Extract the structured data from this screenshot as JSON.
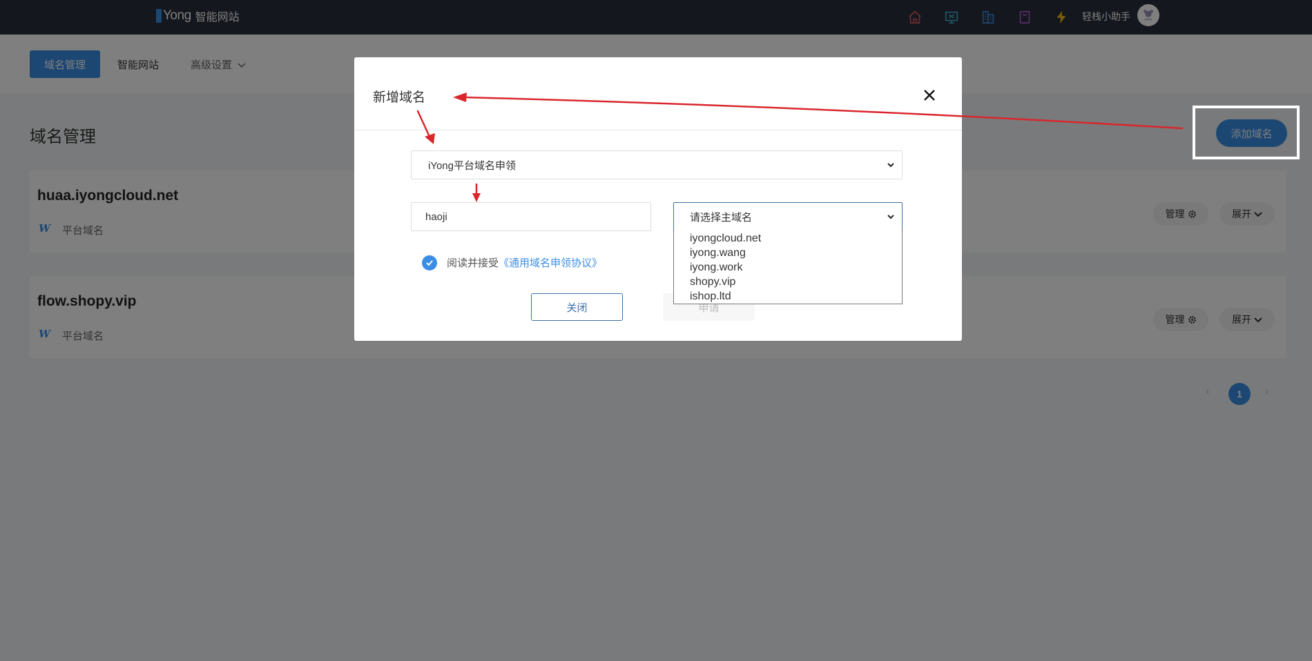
{
  "header": {
    "brand": "Yong",
    "brand_suffix": "智能网站",
    "assistant_label": "轻栈小助手",
    "icons": [
      "home-icon",
      "monitor-icon",
      "building-icon",
      "bag-icon",
      "lightning-icon"
    ],
    "colors": {
      "home": "#e05a5a",
      "monitor": "#3ab0c8",
      "building": "#3a8ee6",
      "bag": "#b05ad0",
      "lightning": "#f5b800"
    }
  },
  "nav": {
    "tabs": [
      {
        "label": "域名管理",
        "active": true
      },
      {
        "label": "智能网站",
        "active": false
      },
      {
        "label": "高级设置",
        "active": false
      }
    ]
  },
  "page": {
    "title": "域名管理",
    "add_button": "添加域名"
  },
  "domains": [
    {
      "name": "huaa.iyongcloud.net",
      "type": "平台域名",
      "manage": "管理",
      "expand": "展开"
    },
    {
      "name": "flow.shopy.vip",
      "type": "平台域名",
      "manage": "管理",
      "expand": "展开"
    }
  ],
  "pagination": {
    "current": "1"
  },
  "modal": {
    "title": "新增域名",
    "type_select": "iYong平台域名申领",
    "subdomain_value": "haoji",
    "main_domain_select": "请选择主域名",
    "main_domain_options": [
      "iyongcloud.net",
      "iyong.wang",
      "iyong.work",
      "shopy.vip",
      "ishop.ltd"
    ],
    "agree_text": "阅读并接受",
    "agree_link": "《通用域名申领协议》",
    "close_button": "关闭",
    "apply_button": "申请"
  },
  "colors": {
    "accent": "#3a8ee6",
    "topbar": "#2b2f3f",
    "annotation": "#d9262c"
  }
}
